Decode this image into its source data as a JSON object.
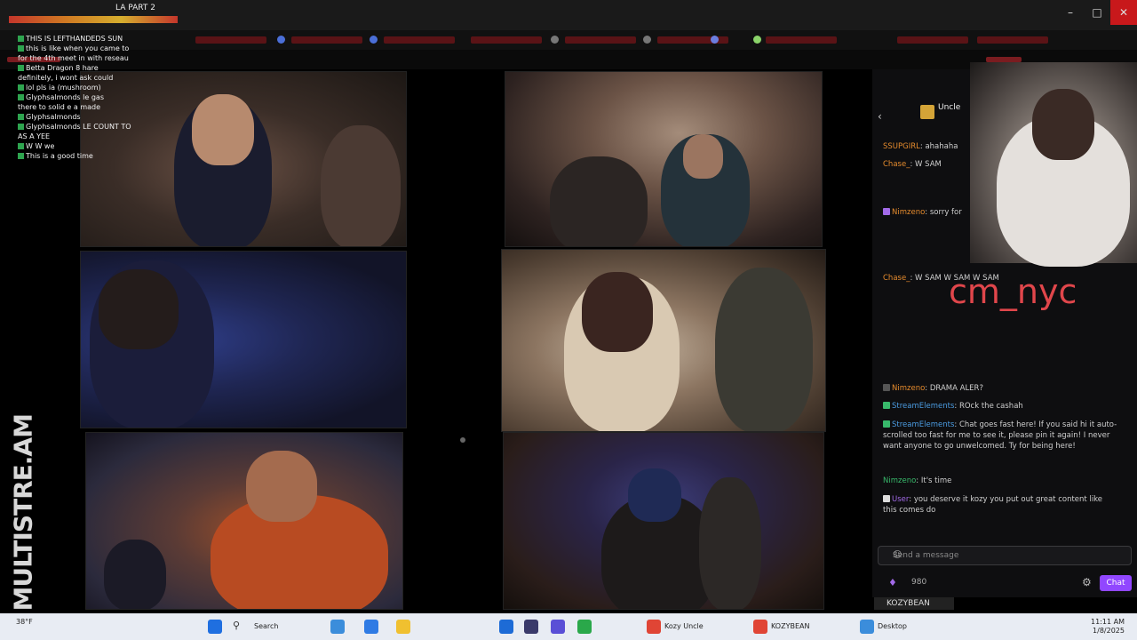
{
  "browser": {
    "tab_title": "LA PART 2"
  },
  "overlay_chat": {
    "lines": [
      "THIS IS LEFTHANDEDS SUN",
      "this is like when you came to",
      "for the 4th meet in with reseau",
      "Betta Dragon 8 hare",
      "definitely, i wont ask could",
      "lol pls ia (mushroom)",
      "Glyphsalmonds le gas",
      "there to solid e a made",
      "Glyphsalmonds",
      "Glyphsalmonds LE COUNT TO",
      "AS A YEE",
      "W W we",
      "This is a good time"
    ]
  },
  "side_brand": "MULTISTRE.AM",
  "chat_panel": {
    "channel_name": "Uncle",
    "messages": [
      {
        "user": "SSUPGIRL",
        "text": "ahahaha"
      },
      {
        "user": "Chase_",
        "text": "W SAM"
      },
      {
        "user": "Nimzeno",
        "text": "sorry for"
      },
      {
        "user": "Chase_",
        "text": "W SAM W SAM W SAM"
      },
      {
        "user": "StreamElements",
        "text": "Chat goes fast here! If you said hi it auto-scrolled too fast for me to see it, please pin it again! I never want anyone to go unwelcomed. Ty for being here!"
      },
      {
        "user": "Nimzeno",
        "text": "DRAMA ALER?"
      },
      {
        "user": "StreamElements",
        "text": "ROck the cashah"
      },
      {
        "user": "Nimzeno",
        "text": "It's time"
      },
      {
        "user": "User",
        "text": "you deserve it kozy you put out great content like this comes do"
      }
    ],
    "overlay_tag": "cm_nyc",
    "input_placeholder": "Send a message",
    "points": "980",
    "chat_button": "Chat"
  },
  "channel_tag": "KOZYBEAN",
  "taskbar": {
    "weather": "38°F",
    "apps": [
      "Search",
      "Kozy Uncle",
      "KOZYBEAN",
      "Desktop"
    ],
    "time": "11:11 AM",
    "date": "1/8/2025"
  },
  "colors": {
    "brand_purple": "#9147ff",
    "accent_red": "#c8181b",
    "overlay_red": "#e0464b"
  }
}
